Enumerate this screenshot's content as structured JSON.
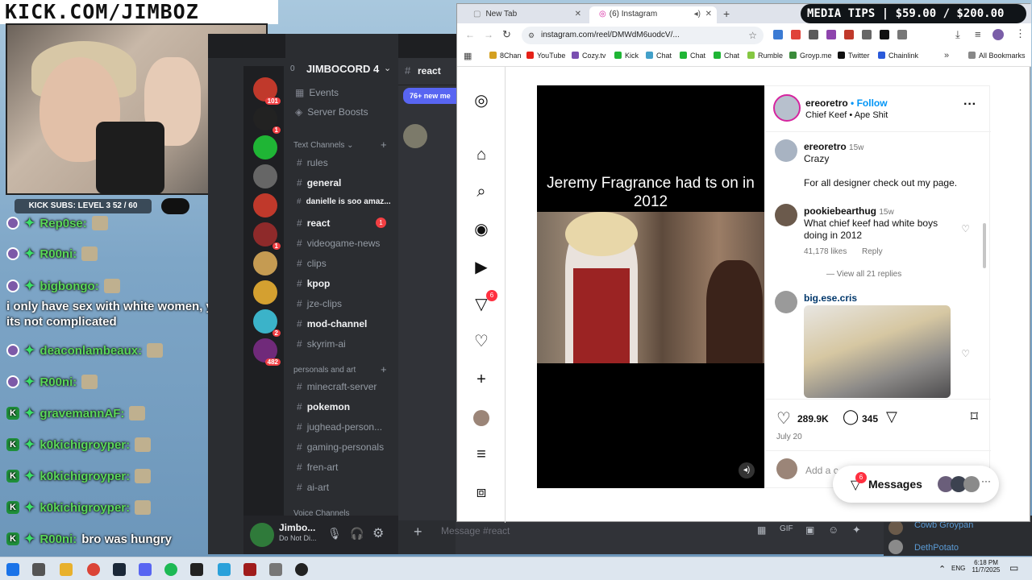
{
  "overlay": {
    "stream_url": "KICK.COM/JIMBOZ",
    "subs_label": "KICK SUBS: LEVEL 3 52 / 60",
    "media_tips": "MEDIA TIPS | $59.00 / $200.00"
  },
  "chat": [
    {
      "badge": "dot",
      "user": "Rep0se:",
      "msg": ""
    },
    {
      "badge": "dot",
      "user": "R00ni:",
      "msg": ""
    },
    {
      "badge": "dot",
      "user": "bigbongo:",
      "msg": ""
    },
    {
      "badge": "none",
      "user": "",
      "msg": "i only have sex with white women, you see. its not complicated"
    },
    {
      "badge": "dot",
      "user": "deaconlambeaux:",
      "msg": ""
    },
    {
      "badge": "dot",
      "user": "R00ni:",
      "msg": ""
    },
    {
      "badge": "k",
      "user": "gravemannAF:",
      "msg": ""
    },
    {
      "badge": "k",
      "user": "k0kichigroyper:",
      "msg": ""
    },
    {
      "badge": "k",
      "user": "k0kichigroyper:",
      "msg": ""
    },
    {
      "badge": "k",
      "user": "k0kichigroyper:",
      "msg": ""
    },
    {
      "badge": "k",
      "user": "R00ni:",
      "msg": "bro was hungry"
    }
  ],
  "discord": {
    "server_name": "JIMBOCORD 4",
    "server_count": "0",
    "channel_header": "react",
    "new_messages": "76+ new me",
    "events": "Events",
    "boosts": "Server Boosts",
    "cat_text": "Text Channels",
    "cat_personals": "personals and art",
    "cat_voice": "Voice Channels",
    "channels": [
      {
        "name": "rules",
        "bold": false
      },
      {
        "name": "general",
        "bold": true
      },
      {
        "name": "danielle is soo amaz...",
        "bold": true
      },
      {
        "name": "react",
        "bold": true,
        "unread": "1"
      },
      {
        "name": "videogame-news",
        "bold": false
      },
      {
        "name": "clips",
        "bold": false
      },
      {
        "name": "kpop",
        "bold": true
      },
      {
        "name": "jze-clips",
        "bold": false
      },
      {
        "name": "mod-channel",
        "bold": true
      },
      {
        "name": "skyrim-ai",
        "bold": false
      }
    ],
    "channels2": [
      {
        "name": "minecraft-server",
        "bold": false
      },
      {
        "name": "pokemon",
        "bold": true
      },
      {
        "name": "jughead-person...",
        "bold": false
      },
      {
        "name": "gaming-personals",
        "bold": false
      },
      {
        "name": "fren-art",
        "bold": false
      },
      {
        "name": "ai-art",
        "bold": false
      }
    ],
    "guild_badges": [
      "101",
      "1",
      "",
      "",
      "",
      "1",
      "",
      "",
      "2",
      "482"
    ],
    "new_label": "NEW",
    "user_name": "Jimbo...",
    "user_status": "Do Not Di...",
    "message_placeholder": "Message #react"
  },
  "browser": {
    "tabs": [
      {
        "label": "New Tab"
      },
      {
        "label": "(6) Instagram"
      }
    ],
    "url": "instagram.com/reel/DMWdM6uodcV/...",
    "bookmarks": [
      "8Chan",
      "YouTube",
      "Cozy.tv",
      "Kick",
      "Chat",
      "Chat",
      "Chat",
      "Rumble",
      "Groyp.me",
      "Twitter",
      "Chainlink"
    ],
    "all_bookmarks": "All Bookmarks"
  },
  "instagram": {
    "notif_count": "6",
    "video_caption": "Jeremy Fragrance had ts on in 2012",
    "post_user": "ereoretro",
    "follow": "Follow",
    "audio": "Chief Keef • Ape Shit",
    "comments": [
      {
        "user": "ereoretro",
        "time": "15w",
        "text": "Crazy",
        "text2": "For all designer check out my page."
      },
      {
        "user": "pookiebearthug",
        "time": "15w",
        "text": "What chief keef had white boys",
        "text2": "doing in 2012",
        "likes": "41,178 likes",
        "reply": "Reply",
        "view_replies": "View all 21 replies"
      },
      {
        "user": "big.ese.cris",
        "time": "",
        "text": ""
      }
    ],
    "like_count": "289.9K",
    "comment_count": "345",
    "date": "July 20",
    "add_comment": "Add a c",
    "messages_label": "Messages",
    "messages_badge": "6"
  },
  "bgwindow": {
    "users": [
      "Cowb Groypan",
      "DethPotato"
    ]
  },
  "taskbar": {
    "lang": "ENG",
    "time": "6:18 PM",
    "date": "11/7/2025"
  }
}
